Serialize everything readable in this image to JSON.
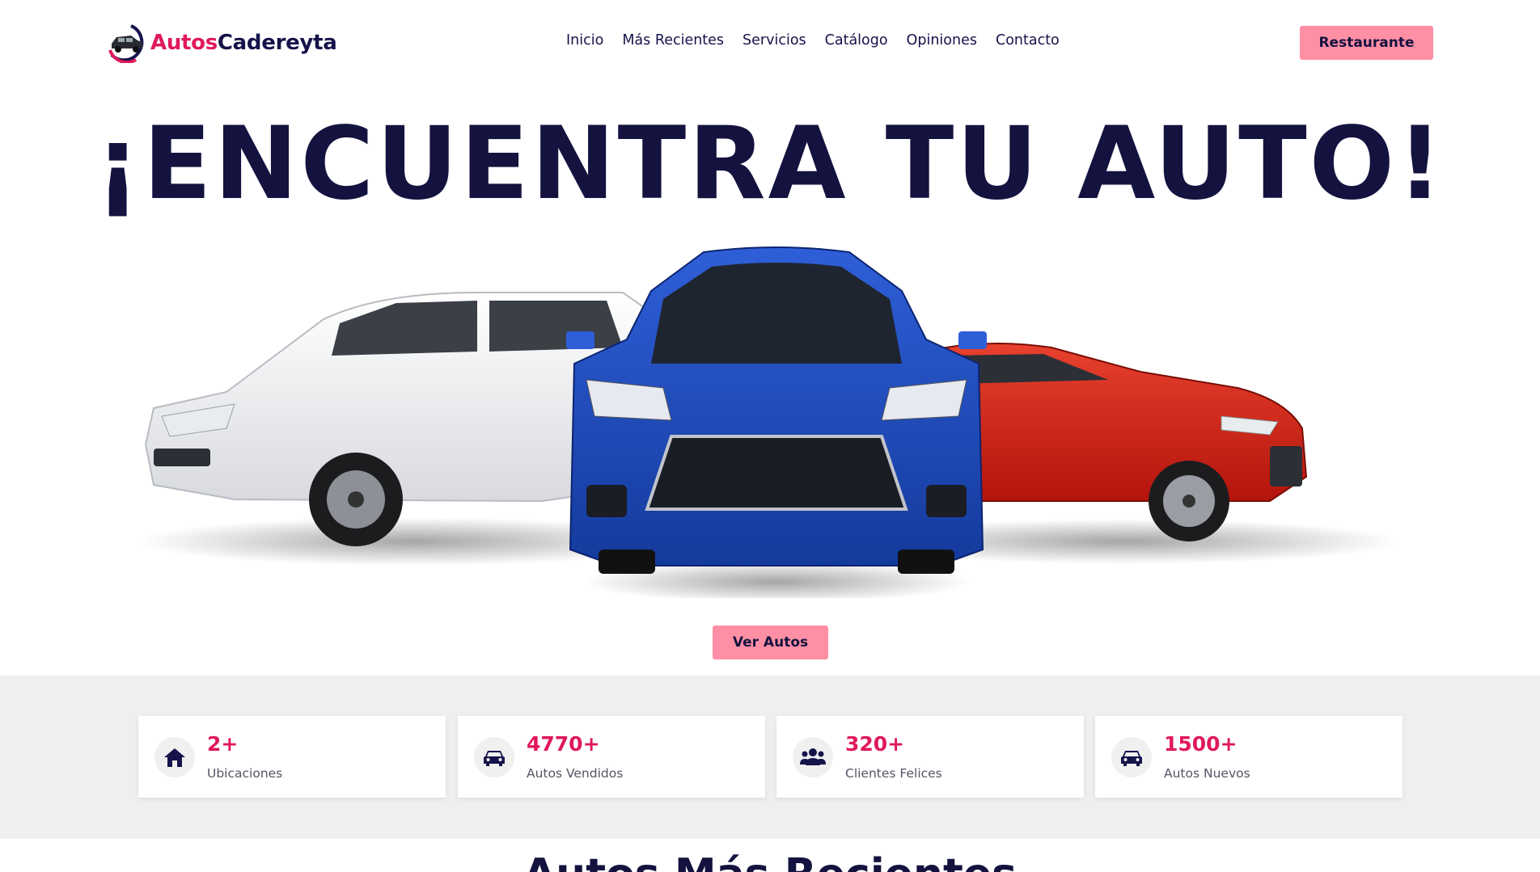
{
  "brand": {
    "part1": "Autos",
    "part2": "Cadereyta",
    "mark_text": "Autos Cadereyta",
    "accent_color": "#e0195b",
    "dark_color": "#15134a"
  },
  "nav": {
    "items": [
      {
        "label": "Inicio"
      },
      {
        "label": "Más Recientes"
      },
      {
        "label": "Servicios"
      },
      {
        "label": "Catálogo"
      },
      {
        "label": "Opiniones"
      },
      {
        "label": "Contacto"
      }
    ],
    "cta_label": "Restaurante"
  },
  "hero": {
    "title": "¡ENCUENTRA TU AUTO!",
    "cta_label": "Ver Autos",
    "image_alt": "three cars: white SUV, blue crossover, red sedan",
    "button_color": "#ff8fa5"
  },
  "stats": [
    {
      "icon": "home-icon",
      "value": "2+",
      "label": "Ubicaciones"
    },
    {
      "icon": "car-icon",
      "value": "4770+",
      "label": "Autos Vendidos"
    },
    {
      "icon": "users-icon",
      "value": "320+",
      "label": "Clientes Felices"
    },
    {
      "icon": "car-icon",
      "value": "1500+",
      "label": "Autos Nuevos"
    }
  ],
  "next_section": {
    "title": "Autos Más Recientes"
  }
}
